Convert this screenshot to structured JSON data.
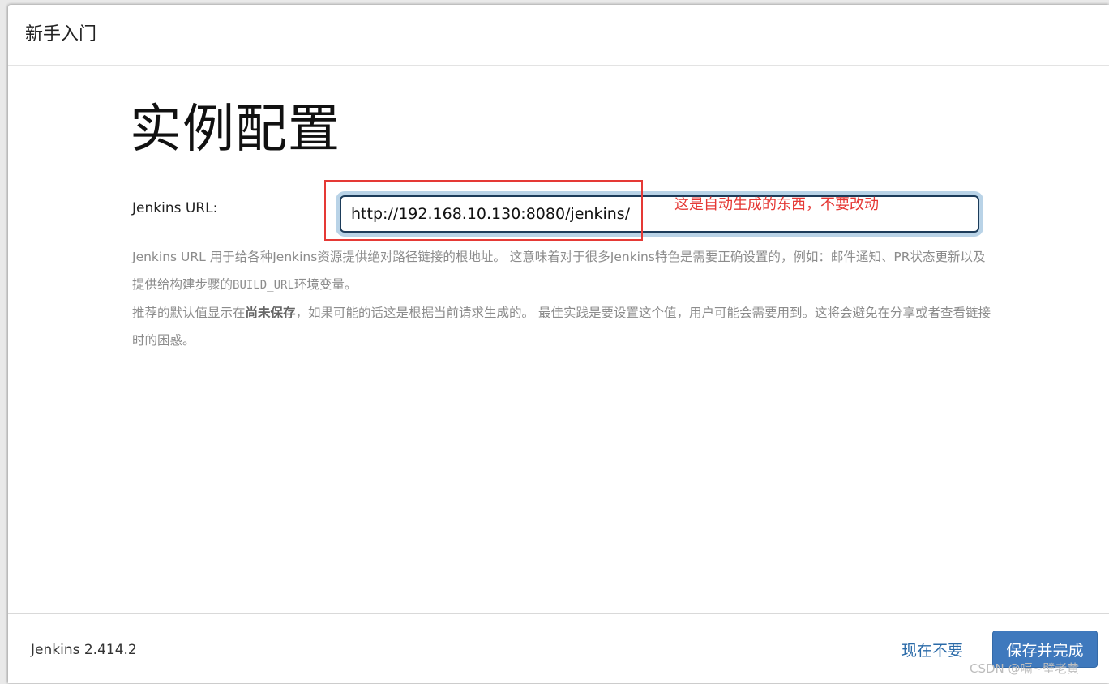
{
  "header": {
    "title": "新手入门"
  },
  "main": {
    "title": "实例配置",
    "url_label": "Jenkins URL:",
    "url_value": "http://192.168.10.130:8080/jenkins/",
    "help": {
      "p1_a": "Jenkins URL 用于给各种Jenkins资源提供绝对路径链接的根地址。 这意味着对于很多Jenkins特色是需要正确设置的，例如：邮件通知、PR状态更新以及提供给构建步骤的",
      "p1_code": "BUILD_URL",
      "p1_b": "环境变量。",
      "p2_a": "推荐的默认值显示在",
      "p2_strong": "尚未保存",
      "p2_b": "，如果可能的话这是根据当前请求生成的。 最佳实践是要设置这个值，用户可能会需要用到。这将会避免在分享或者查看链接时的困惑。"
    }
  },
  "annotation": {
    "text": "这是自动生成的东西，不要改动",
    "color": "#e53935"
  },
  "footer": {
    "version": "Jenkins 2.414.2",
    "skip_label": "现在不要",
    "save_label": "保存并完成"
  },
  "watermark": "CSDN @嗝~壁老黄",
  "colors": {
    "primary_button": "#3f79bd",
    "link": "#2a6aa8",
    "input_border": "#1d3c5a",
    "input_focus_ring": "#b9d3e7"
  }
}
